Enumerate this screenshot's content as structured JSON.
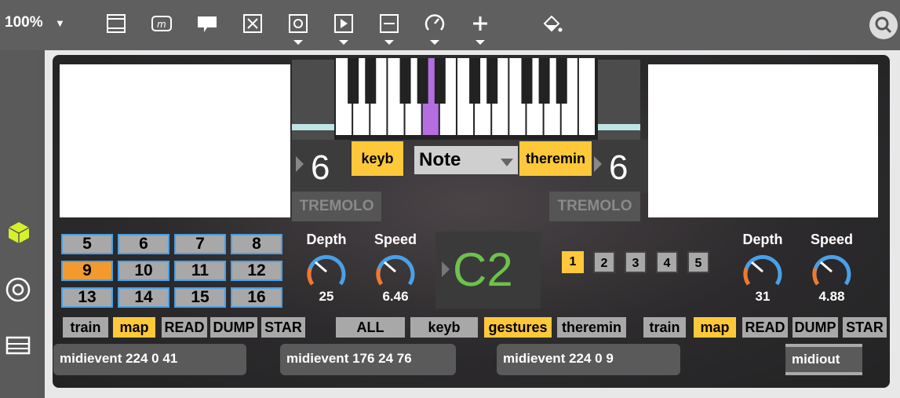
{
  "toolbar": {
    "zoom": "100%",
    "icons": [
      "presentation-icon",
      "message-icon",
      "comment-icon",
      "toggle-icon",
      "button-icon",
      "playbar-icon",
      "slider-icon",
      "dial-icon",
      "add-icon",
      "paint-bucket-icon",
      "search-icon"
    ]
  },
  "sidebar": {
    "icons": [
      "cube-icon",
      "target-icon",
      "monitor-icon"
    ],
    "active_color": "#d6f02a"
  },
  "patch": {
    "left_number": "6",
    "right_number": "6",
    "tremolo_left": "TREMOLO",
    "tremolo_right": "TREMOLO",
    "keyb_label": "keyb",
    "note_menu": "Note",
    "theremin_label": "theremin",
    "grid": [
      "5",
      "6",
      "7",
      "8",
      "9",
      "10",
      "11",
      "12",
      "13",
      "14",
      "15",
      "16"
    ],
    "grid_active": "9",
    "left_knobs": [
      {
        "label": "Depth",
        "value": "25"
      },
      {
        "label": "Speed",
        "value": "6.46"
      }
    ],
    "right_knobs": [
      {
        "label": "Depth",
        "value": "31"
      },
      {
        "label": "Speed",
        "value": "4.88"
      }
    ],
    "note_display": "C2",
    "note_color": "#6cc24a",
    "preset_buttons": [
      "1",
      "2",
      "3",
      "4",
      "5"
    ],
    "preset_active": "1",
    "left_buttons": {
      "train": "train",
      "map": "map",
      "read": "READ",
      "dump": "DUMP",
      "star": "STAR"
    },
    "mid_buttons": {
      "all": "ALL",
      "keyb": "keyb",
      "gestures": "gestures",
      "theremin": "theremin"
    },
    "right_buttons": {
      "train": "train",
      "map": "map",
      "read": "READ",
      "dump": "DUMP",
      "star": "STAR"
    },
    "messages": [
      "midievent 224 0 41",
      "midievent 176 24 76",
      "midievent 224 0 9"
    ],
    "midiout": "midiout",
    "accent": "#fec83a",
    "blue": "#4aa0e6",
    "orange": "#f39a2f",
    "purple": "#b46ee0"
  }
}
